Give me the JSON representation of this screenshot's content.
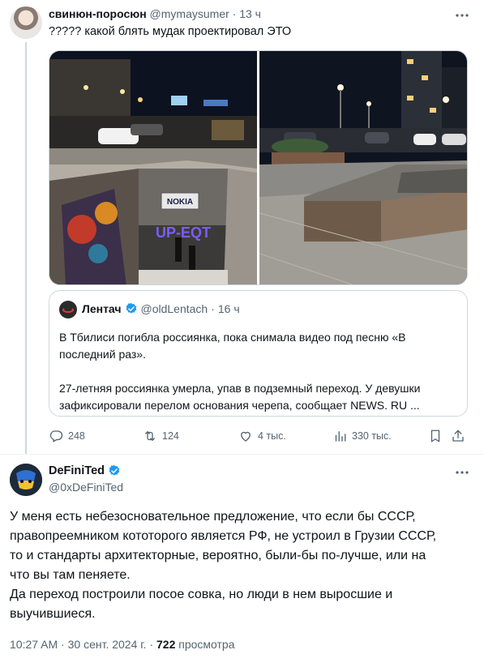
{
  "tweet1": {
    "author_name": "свинюн-поросюн",
    "author_handle": "@mymaysumer",
    "separator": "·",
    "time": "13 ч",
    "text": "????? какой блять мудак проектировал ЭТО",
    "photo_left": {
      "sign_text": "NOKIA",
      "graffiti_text": "UP-EQT"
    },
    "quote": {
      "author_name": "Лентач",
      "author_handle": "@oldLentach",
      "separator": "·",
      "time": "16 ч",
      "paragraph1": "В Тбилиси погибла россиянка, пока снимала видео под песню «В последний раз».",
      "paragraph2": "27-летняя россиянка умерла, упав в подземный переход. У девушки зафиксировали перелом основания черепа, сообщает NEWS. RU ..."
    },
    "actions": {
      "replies": "248",
      "reposts": "124",
      "likes": "4 тыс.",
      "views": "330 тыс."
    }
  },
  "tweet2": {
    "author_name": "DeFiniTed",
    "author_handle": "@0xDeFiniTed",
    "line1": "У меня есть небезосновательное предложение, что если бы СССР,",
    "line2": "правопреемником кототорого является РФ, не устроил в Грузии СССР,",
    "line3": "то и стандарты архитекторные, вероятно, были-бы по-лучше, или на",
    "line4": "что вы там пеняете.",
    "line5": "Да переход построили посое совка, но люди в нем выросшие и",
    "line6": "выучившиеся.",
    "time": "10:27 AM",
    "separator": "·",
    "date": "30 сент. 2024 г.",
    "views_count": "722",
    "views_label": "просмотра"
  },
  "colors": {
    "text": "#0f1419",
    "secondary": "#536471",
    "border": "#cfd9de",
    "verified": "#1d9bf0"
  }
}
